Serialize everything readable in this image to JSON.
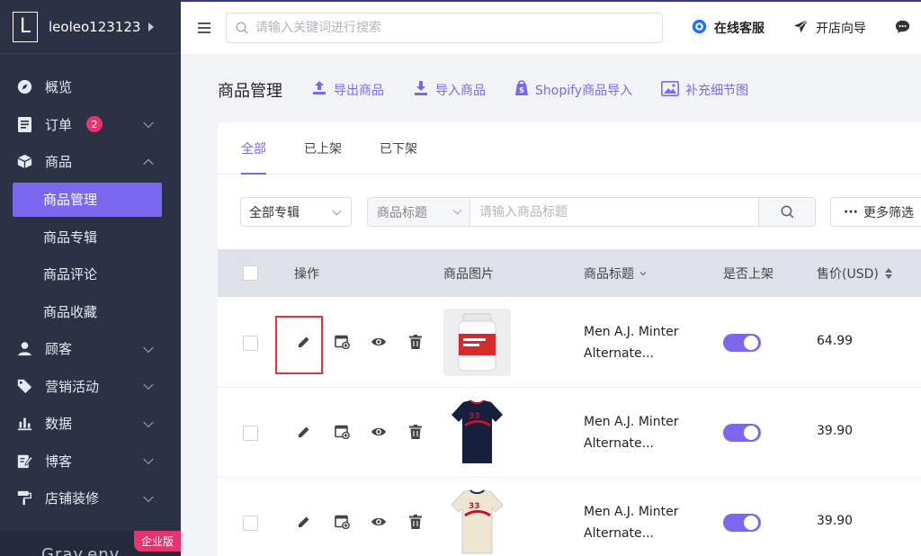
{
  "sidebar": {
    "logo_letter": "L",
    "user_name": "leoleo123123",
    "items": [
      {
        "label": "概览",
        "icon": "compass-icon"
      },
      {
        "label": "订单",
        "icon": "order-icon",
        "badge": "2"
      },
      {
        "label": "商品",
        "icon": "box-icon"
      },
      {
        "label": "顾客",
        "icon": "user-icon"
      },
      {
        "label": "营销活动",
        "icon": "tag-icon"
      },
      {
        "label": "数据",
        "icon": "bar-chart-icon"
      },
      {
        "label": "博客",
        "icon": "blog-icon"
      },
      {
        "label": "店铺装修",
        "icon": "paint-roller-icon"
      }
    ],
    "sub_items": [
      "商品管理",
      "商品专辑",
      "商品评论",
      "商品收藏"
    ],
    "enterprise_badge": "企业版",
    "footer_text": "Gray.env"
  },
  "topbar": {
    "search_placeholder": "请输入关键词进行搜索",
    "support_label": "在线客服",
    "guide_label": "开店向导"
  },
  "header": {
    "title": "商品管理",
    "actions": [
      "导出商品",
      "导入商品",
      "Shopify商品导入",
      "补充细节图"
    ]
  },
  "tabs": [
    "全部",
    "已上架",
    "已下架"
  ],
  "filters": {
    "album_select": "全部专辑",
    "title_select": "商品标题",
    "title_placeholder": "请输入商品标题",
    "more_label": "更多筛选"
  },
  "table": {
    "columns": [
      "操作",
      "商品图片",
      "商品标题",
      "是否上架",
      "售价(USD)"
    ],
    "rows": [
      {
        "title_line1": "Men A.J. Minter",
        "title_line2": "Alternate...",
        "price": "64.99",
        "listed": true
      },
      {
        "title_line1": "Men A.J. Minter",
        "title_line2": "Alternate...",
        "price": "39.90",
        "listed": true
      },
      {
        "title_line1": "Men A.J. Minter",
        "title_line2": "Alternate...",
        "price": "39.90",
        "listed": true
      }
    ]
  },
  "colors": {
    "accent": "#7b68ee",
    "sidebar_bg": "#2b3245",
    "badge": "#e7336f",
    "highlight": "#e4333a"
  }
}
